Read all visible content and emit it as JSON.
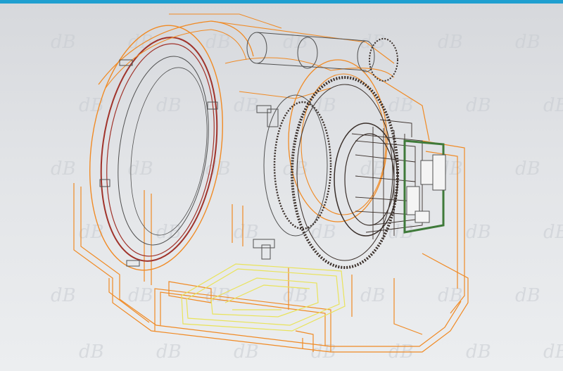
{
  "viewport": {
    "background_top": "#d6d8dc",
    "background_bottom": "#eceef0",
    "accent_bar_color": "#1f9fd0"
  },
  "watermark": {
    "logo_text": "dB",
    "color": "#c7cbd1"
  },
  "model": {
    "housing_color": "#f08a24",
    "ring_color": "#a0332b",
    "gear_color": "#3a2f2a",
    "base_plate_color": "#e9e35a",
    "connector_color": "#3f7a3a",
    "connector_face_color": "#f4f4f4",
    "wire_color": "#505050"
  }
}
